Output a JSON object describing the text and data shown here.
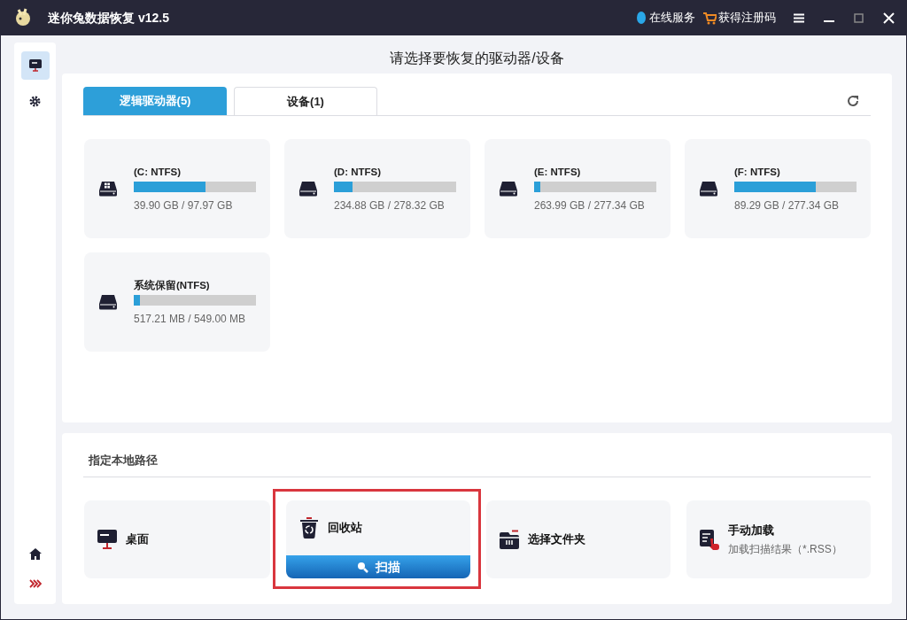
{
  "window": {
    "title": "迷你兔数据恢复 v12.5",
    "online_service": "在线服务",
    "get_code": "获得注册码"
  },
  "sidebar": {
    "items": [
      {
        "kind": "drives",
        "selected": true
      },
      {
        "kind": "settings",
        "selected": false
      }
    ]
  },
  "heading": "请选择要恢复的驱动器/设备",
  "tabs": [
    {
      "label": "逻辑驱动器(5)",
      "selected": true
    },
    {
      "label": "设备(1)",
      "selected": false
    }
  ],
  "drives": [
    {
      "kind": "windows",
      "name": "(C: NTFS)",
      "level": 0.59,
      "size": "39.90 GB / 97.97 GB"
    },
    {
      "kind": "disk",
      "name": "(D: NTFS)",
      "level": 0.15,
      "size": "234.88 GB / 278.32 GB"
    },
    {
      "kind": "disk",
      "name": "(E: NTFS)",
      "level": 0.05,
      "size": "263.99 GB / 277.34 GB"
    },
    {
      "kind": "disk",
      "name": "(F: NTFS)",
      "level": 0.67,
      "size": "89.29 GB / 277.34 GB"
    },
    {
      "kind": "disk",
      "name": "系统保留(NTFS)",
      "level": 0.05,
      "size": "517.21 MB / 549.00 MB"
    }
  ],
  "local_paths": {
    "title": "指定本地路径",
    "items": [
      {
        "kind": "desktop",
        "label": "桌面",
        "highlighted": false
      },
      {
        "kind": "recycle",
        "label": "回收站",
        "highlighted": true,
        "button": "扫描"
      },
      {
        "kind": "folder",
        "label": "选择文件夹",
        "highlighted": false
      },
      {
        "kind": "load",
        "label": "手动加载",
        "subtitle": "加载扫描结果（*.RSS）",
        "highlighted": false
      }
    ]
  }
}
